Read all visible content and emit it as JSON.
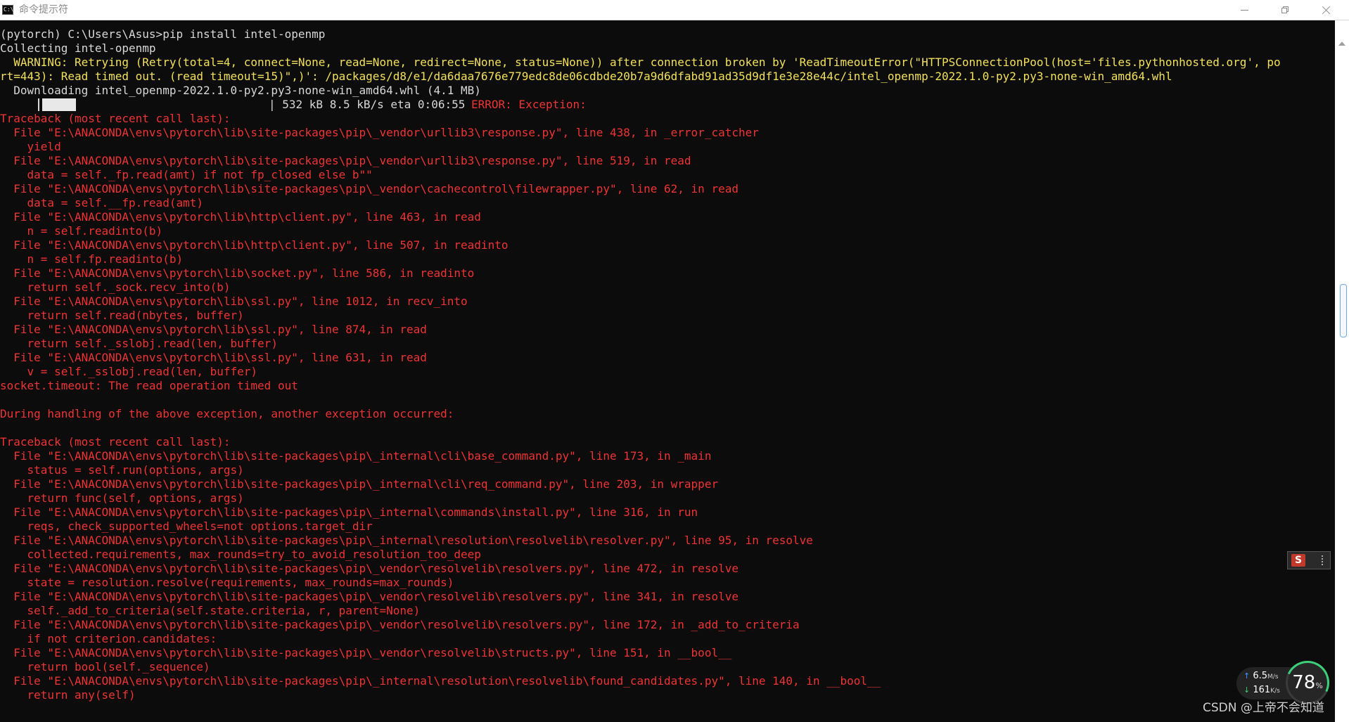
{
  "window": {
    "title": "命令提示符",
    "app_icon_text": "C:\\"
  },
  "console": {
    "lines": [
      {
        "text": "(pytorch) C:\\Users\\Asus>pip install intel-openmp",
        "color": "white"
      },
      {
        "text": "Collecting intel-openmp",
        "color": "white"
      },
      {
        "text": "  WARNING: Retrying (Retry(total=4, connect=None, read=None, redirect=None, status=None)) after connection broken by 'ReadTimeoutError(\"HTTPSConnectionPool(host='files.pythonhosted.org', po",
        "color": "yellow"
      },
      {
        "text": "rt=443): Read timed out. (read timeout=15)\",)': /packages/d8/e1/da6daa7676e779edc8de06cdbde20b7a9d6dfabd91ad35d9df1e3e28e44c/intel_openmp-2022.1.0-py2.py3-none-win_amd64.whl",
        "color": "yellow"
      },
      {
        "text": "  Downloading intel_openmp-2022.1.0-py2.py3-none-win_amd64.whl (4.1 MB)",
        "color": "white"
      },
      {
        "text": "",
        "color": "white",
        "progress": true
      },
      {
        "text": "Traceback (most recent call last):",
        "color": "red"
      },
      {
        "text": "  File \"E:\\ANACONDA\\envs\\pytorch\\lib\\site-packages\\pip\\_vendor\\urllib3\\response.py\", line 438, in _error_catcher",
        "color": "red"
      },
      {
        "text": "    yield",
        "color": "red"
      },
      {
        "text": "  File \"E:\\ANACONDA\\envs\\pytorch\\lib\\site-packages\\pip\\_vendor\\urllib3\\response.py\", line 519, in read",
        "color": "red"
      },
      {
        "text": "    data = self._fp.read(amt) if not fp_closed else b\"\"",
        "color": "red"
      },
      {
        "text": "  File \"E:\\ANACONDA\\envs\\pytorch\\lib\\site-packages\\pip\\_vendor\\cachecontrol\\filewrapper.py\", line 62, in read",
        "color": "red"
      },
      {
        "text": "    data = self.__fp.read(amt)",
        "color": "red"
      },
      {
        "text": "  File \"E:\\ANACONDA\\envs\\pytorch\\lib\\http\\client.py\", line 463, in read",
        "color": "red"
      },
      {
        "text": "    n = self.readinto(b)",
        "color": "red"
      },
      {
        "text": "  File \"E:\\ANACONDA\\envs\\pytorch\\lib\\http\\client.py\", line 507, in readinto",
        "color": "red"
      },
      {
        "text": "    n = self.fp.readinto(b)",
        "color": "red"
      },
      {
        "text": "  File \"E:\\ANACONDA\\envs\\pytorch\\lib\\socket.py\", line 586, in readinto",
        "color": "red"
      },
      {
        "text": "    return self._sock.recv_into(b)",
        "color": "red"
      },
      {
        "text": "  File \"E:\\ANACONDA\\envs\\pytorch\\lib\\ssl.py\", line 1012, in recv_into",
        "color": "red"
      },
      {
        "text": "    return self.read(nbytes, buffer)",
        "color": "red"
      },
      {
        "text": "  File \"E:\\ANACONDA\\envs\\pytorch\\lib\\ssl.py\", line 874, in read",
        "color": "red"
      },
      {
        "text": "    return self._sslobj.read(len, buffer)",
        "color": "red"
      },
      {
        "text": "  File \"E:\\ANACONDA\\envs\\pytorch\\lib\\ssl.py\", line 631, in read",
        "color": "red"
      },
      {
        "text": "    v = self._sslobj.read(len, buffer)",
        "color": "red"
      },
      {
        "text": "socket.timeout: The read operation timed out",
        "color": "red"
      },
      {
        "text": "",
        "color": "red"
      },
      {
        "text": "During handling of the above exception, another exception occurred:",
        "color": "red"
      },
      {
        "text": "",
        "color": "red"
      },
      {
        "text": "Traceback (most recent call last):",
        "color": "red"
      },
      {
        "text": "  File \"E:\\ANACONDA\\envs\\pytorch\\lib\\site-packages\\pip\\_internal\\cli\\base_command.py\", line 173, in _main",
        "color": "red"
      },
      {
        "text": "    status = self.run(options, args)",
        "color": "red"
      },
      {
        "text": "  File \"E:\\ANACONDA\\envs\\pytorch\\lib\\site-packages\\pip\\_internal\\cli\\req_command.py\", line 203, in wrapper",
        "color": "red"
      },
      {
        "text": "    return func(self, options, args)",
        "color": "red"
      },
      {
        "text": "  File \"E:\\ANACONDA\\envs\\pytorch\\lib\\site-packages\\pip\\_internal\\commands\\install.py\", line 316, in run",
        "color": "red"
      },
      {
        "text": "    reqs, check_supported_wheels=not options.target_dir",
        "color": "red"
      },
      {
        "text": "  File \"E:\\ANACONDA\\envs\\pytorch\\lib\\site-packages\\pip\\_internal\\resolution\\resolvelib\\resolver.py\", line 95, in resolve",
        "color": "red"
      },
      {
        "text": "    collected.requirements, max_rounds=try_to_avoid_resolution_too_deep",
        "color": "red"
      },
      {
        "text": "  File \"E:\\ANACONDA\\envs\\pytorch\\lib\\site-packages\\pip\\_vendor\\resolvelib\\resolvers.py\", line 472, in resolve",
        "color": "red"
      },
      {
        "text": "    state = resolution.resolve(requirements, max_rounds=max_rounds)",
        "color": "red"
      },
      {
        "text": "  File \"E:\\ANACONDA\\envs\\pytorch\\lib\\site-packages\\pip\\_vendor\\resolvelib\\resolvers.py\", line 341, in resolve",
        "color": "red"
      },
      {
        "text": "    self._add_to_criteria(self.state.criteria, r, parent=None)",
        "color": "red"
      },
      {
        "text": "  File \"E:\\ANACONDA\\envs\\pytorch\\lib\\site-packages\\pip\\_vendor\\resolvelib\\resolvers.py\", line 172, in _add_to_criteria",
        "color": "red"
      },
      {
        "text": "    if not criterion.candidates:",
        "color": "red"
      },
      {
        "text": "  File \"E:\\ANACONDA\\envs\\pytorch\\lib\\site-packages\\pip\\_vendor\\resolvelib\\structs.py\", line 151, in __bool__",
        "color": "red"
      },
      {
        "text": "    return bool(self._sequence)",
        "color": "red"
      },
      {
        "text": "  File \"E:\\ANACONDA\\envs\\pytorch\\lib\\site-packages\\pip\\_internal\\resolution\\resolvelib\\found_candidates.py\", line 140, in __bool__",
        "color": "red"
      },
      {
        "text": "    return any(self)",
        "color": "red"
      }
    ],
    "progress": {
      "status_text": "| 532 kB 8.5 kB/s eta 0:06:55",
      "error_text": "ERROR: Exception:"
    }
  },
  "ime": {
    "logo": "S"
  },
  "net_monitor": {
    "upload_value": "6.5",
    "upload_unit": "M/s",
    "download_value": "161",
    "download_unit": "K/s",
    "percent_value": "78",
    "percent_unit": "%"
  },
  "watermark": "CSDN @上帝不会知道",
  "colors": {
    "white": "#d8d8d8",
    "yellow": "#f2e05c",
    "red": "#ee3434",
    "background": "#0c0c0c"
  }
}
